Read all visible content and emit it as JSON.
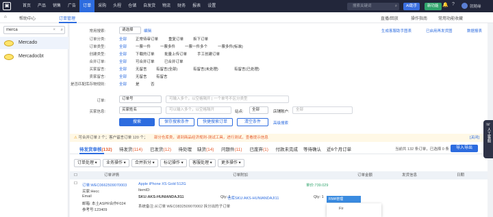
{
  "topnav": {
    "logo": "▣",
    "items": [
      "首页",
      "产品",
      "销售",
      "广告",
      "订单",
      "采购",
      "头程",
      "仓储",
      "自发货",
      "物流",
      "财务",
      "报表",
      "设置"
    ],
    "active_index": 4,
    "search_placeholder": "搜索关键词",
    "ai_label": "AI助手",
    "new_label": "新功能",
    "user": "就随缘"
  },
  "subbar": {
    "home": "帮助中心",
    "current": "订单管理",
    "link1": "直播/回放",
    "link2": "操作指南",
    "link3": "常用功能收藏"
  },
  "sidebar": {
    "search": "merca",
    "items": [
      {
        "label": "Mercado"
      },
      {
        "label": "Mercadocbt"
      }
    ]
  },
  "filters": {
    "common_search_label": "常用搜索:",
    "common_search_value": "请选择",
    "common_search_edit": "编辑",
    "right_links": [
      "生成客服助手图表",
      "已启用再发货图",
      "数据报表"
    ],
    "rows": [
      {
        "label": "订单分类:",
        "opts": [
          "全部",
          "正常待审订单",
          "重复订单",
          "拆下订单"
        ]
      },
      {
        "label": "订单类型:",
        "opts": [
          "全部",
          "一票一件",
          "一票多件",
          "一票一件多个",
          "一票多件(标准)"
        ]
      },
      {
        "label": "创建类型:",
        "opts": [
          "全部",
          "下载的订单",
          "批量上传订单",
          "手工创建订单"
        ]
      },
      {
        "label": "合并订单:",
        "opts": [
          "全部",
          "可合并订单",
          "已合并订单"
        ]
      },
      {
        "label": "买家留言:",
        "opts": [
          "全部",
          "无留言",
          "有留言(全部)",
          "有留言(未处理)",
          "有留言(已处理)"
        ]
      },
      {
        "label": "卖家留言:",
        "opts": [
          "全部",
          "无留言",
          "有留言"
        ]
      },
      {
        "label": "是否匹配库存物规则:",
        "opts": [
          "全部",
          "是",
          "否"
        ]
      }
    ],
    "order_label": "订单:",
    "order_field": "订单号",
    "order_placeholder": "可输入多个，以空格隔开 | 一个单号不区分类型",
    "buyer_label": "买家信息:",
    "buyer_field": "买家姓名",
    "buyer_placeholder": "可以输入多个，以空格隔开",
    "site_label": "站点:",
    "site_value": "全部",
    "store_label": "店铺账户:",
    "store_placeholder": "全部",
    "search_btn": "搜索",
    "save_btn": "保存搜索条件",
    "quick_btn": "快捷搜索订单",
    "clear_btn": "清空条件",
    "advanced": "高级搜索"
  },
  "notice": {
    "text": "可合并订单 2 个；客户留言订单 120 个；",
    "warn": "部分仓库类，请到商品经济规则-测试工具，进行测试，查看提示信息",
    "close": "[关闭]"
  },
  "tabs": [
    {
      "label": "待发货审核",
      "count": "(132)"
    },
    {
      "label": "待发货",
      "count": "(114)"
    },
    {
      "label": "已发货",
      "count": "(12)"
    },
    {
      "label": "待处理",
      "count": ""
    },
    {
      "label": "缺货",
      "count": "(14)"
    },
    {
      "label": "问题件",
      "count": "(11)"
    },
    {
      "label": "已废弃",
      "count": "(1)"
    },
    {
      "label": "付款未完成",
      "count": ""
    },
    {
      "label": "等待确认",
      "count": ""
    },
    {
      "label": "近6个月订单",
      "count": ""
    }
  ],
  "tab_summary": "当前共 132 条订单，已选择 0 条",
  "export_btn": "导入导出",
  "actions": [
    "订单处理",
    "业务操作",
    "合并拆分",
    "标记操作",
    "客服处理",
    "更多操作"
  ],
  "table_header": {
    "details": "订单详情",
    "attachments": "订单附加",
    "amount": "订单金额",
    "shipping": "发货信息",
    "date": "日期"
  },
  "order": {
    "id": "订单:WEC0662509070003",
    "line2": "买家:Hecc",
    "line3": "Email",
    "line4": "邮箱: 本土ASPR合作F024",
    "line5": "参考号:123409",
    "product": "Apple iPhone XS Gold 512G",
    "item_id": "ItemID:",
    "sku": "SKU:AKS-HUNIANDAJI11",
    "qty": "Qty: 1",
    "warehouse_sku": "仓库SKU:AKS-HUNIANDAJI11",
    "qty2": "Qty: 1",
    "note": "系统备注:从订单 WEC0832509070002 拆分出的子订单",
    "price": "单价:739.029",
    "rma": "RMA管理",
    "popup": "Fir"
  },
  "float": {
    "label": "人工客服"
  }
}
